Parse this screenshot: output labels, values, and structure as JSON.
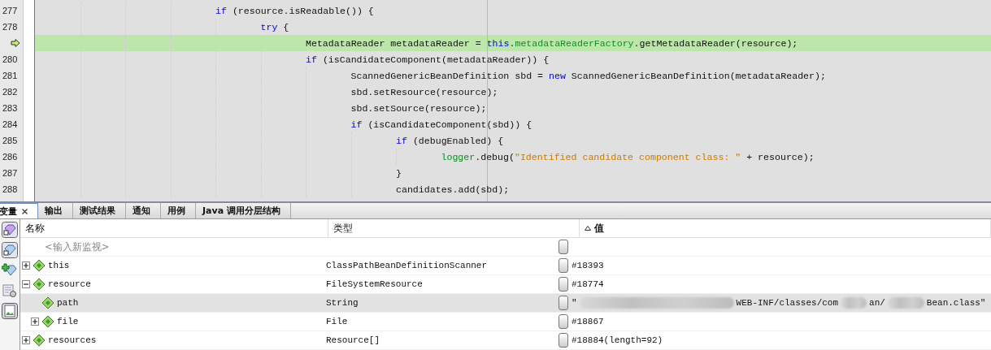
{
  "editor": {
    "lines": [
      {
        "number": "277",
        "current": false,
        "tokens": [
          {
            "kind": "keyword",
            "text": "if"
          },
          {
            "kind": "plain",
            "text": " (resource.isReadable()) {"
          }
        ],
        "children": [
          {
            "number": "278",
            "current": false,
            "tokens": [
              {
                "kind": "keyword",
                "text": "try"
              },
              {
                "kind": "plain",
                "text": " {"
              }
            ],
            "children": [
              {
                "current": true,
                "tokens": [
                  {
                    "kind": "plain",
                    "text": "MetadataReader metadataReader = "
                  },
                  {
                    "kind": "keyword",
                    "text": "this"
                  },
                  {
                    "kind": "plain",
                    "text": "."
                  },
                  {
                    "kind": "field",
                    "text": "metadataReaderFactory"
                  },
                  {
                    "kind": "plain",
                    "text": ".getMetadataReader(resource);"
                  }
                ]
              },
              {
                "number": "280",
                "current": false,
                "tokens": [
                  {
                    "kind": "keyword",
                    "text": "if"
                  },
                  {
                    "kind": "plain",
                    "text": " (isCandidateComponent(metadataReader)) {"
                  }
                ],
                "children": [
                  {
                    "number": "281",
                    "current": false,
                    "tokens": [
                      {
                        "kind": "plain",
                        "text": "ScannedGenericBeanDefinition sbd = "
                      },
                      {
                        "kind": "keyword",
                        "text": "new"
                      },
                      {
                        "kind": "plain",
                        "text": " ScannedGenericBeanDefinition(metadataReader);"
                      }
                    ]
                  },
                  {
                    "number": "282",
                    "current": false,
                    "tokens": [
                      {
                        "kind": "plain",
                        "text": "sbd.setResource(resource);"
                      }
                    ]
                  },
                  {
                    "number": "283",
                    "current": false,
                    "tokens": [
                      {
                        "kind": "plain",
                        "text": "sbd.setSource(resource);"
                      }
                    ]
                  },
                  {
                    "number": "284",
                    "current": false,
                    "tokens": [
                      {
                        "kind": "keyword",
                        "text": "if"
                      },
                      {
                        "kind": "plain",
                        "text": " (isCandidateComponent(sbd)) {"
                      }
                    ],
                    "children": [
                      {
                        "number": "285",
                        "current": false,
                        "tokens": [
                          {
                            "kind": "keyword",
                            "text": "if"
                          },
                          {
                            "kind": "plain",
                            "text": " (debugEnabled) {"
                          }
                        ],
                        "children": [
                          {
                            "number": "286",
                            "current": false,
                            "tokens": [
                              {
                                "kind": "field",
                                "text": "logger"
                              },
                              {
                                "kind": "plain",
                                "text": ".debug("
                              },
                              {
                                "kind": "string",
                                "text": "\"Identified candidate component class: \""
                              },
                              {
                                "kind": "plain",
                                "text": " + resource);"
                              }
                            ]
                          }
                        ]
                      },
                      {
                        "number": "287",
                        "current": false,
                        "tokens": [
                          {
                            "kind": "plain",
                            "text": "}"
                          }
                        ]
                      },
                      {
                        "number": "288",
                        "current": false,
                        "tokens": [
                          {
                            "kind": "plain",
                            "text": "candidates.add(sbd);"
                          }
                        ]
                      }
                    ]
                  }
                ]
              }
            ]
          }
        ]
      }
    ]
  },
  "tabs": [
    {
      "label": "变量",
      "selected": true,
      "closable": true
    },
    {
      "label": "输出",
      "selected": false,
      "closable": false
    },
    {
      "label": "测试结果",
      "selected": false,
      "closable": false
    },
    {
      "label": "通知",
      "selected": false,
      "closable": false
    },
    {
      "label": "用例",
      "selected": false,
      "closable": false
    },
    {
      "label": "Java 调用分层结构",
      "selected": false,
      "closable": false
    }
  ],
  "table": {
    "columns": [
      {
        "label": "名称",
        "sorted": false
      },
      {
        "label": "类型",
        "sorted": false
      },
      {
        "label": "值",
        "sorted": true
      }
    ],
    "watch_placeholder": "<输入新监视>",
    "rows": [
      {
        "name": "this",
        "type": "ClassPathBeanDefinitionScanner",
        "value": [
          {
            "kind": "text",
            "text": "#18393"
          }
        ],
        "expandable": true,
        "expanded": false,
        "selected": false
      },
      {
        "name": "resource",
        "type": "FileSystemResource",
        "value": [
          {
            "kind": "text",
            "text": "#18774"
          }
        ],
        "expandable": true,
        "expanded": true,
        "selected": false,
        "children": [
          {
            "name": "path",
            "type": "String",
            "value": [
              {
                "kind": "text",
                "text": "\""
              },
              {
                "kind": "blur"
              },
              {
                "kind": "text",
                "text": "WEB-INF/classes/com"
              },
              {
                "kind": "blur"
              },
              {
                "kind": "text",
                "text": "an/"
              },
              {
                "kind": "blur"
              },
              {
                "kind": "text",
                "text": "Bean.class\""
              }
            ],
            "expandable": false,
            "selected": true
          },
          {
            "name": "file",
            "type": "File",
            "value": [
              {
                "kind": "text",
                "text": "#18867"
              }
            ],
            "expandable": true,
            "expanded": false,
            "selected": false
          }
        ]
      },
      {
        "name": "resources",
        "type": "Resource[]",
        "value": [
          {
            "kind": "text",
            "text": "#18884(length=92)"
          }
        ],
        "expandable": true,
        "expanded": false,
        "selected": false
      }
    ]
  }
}
